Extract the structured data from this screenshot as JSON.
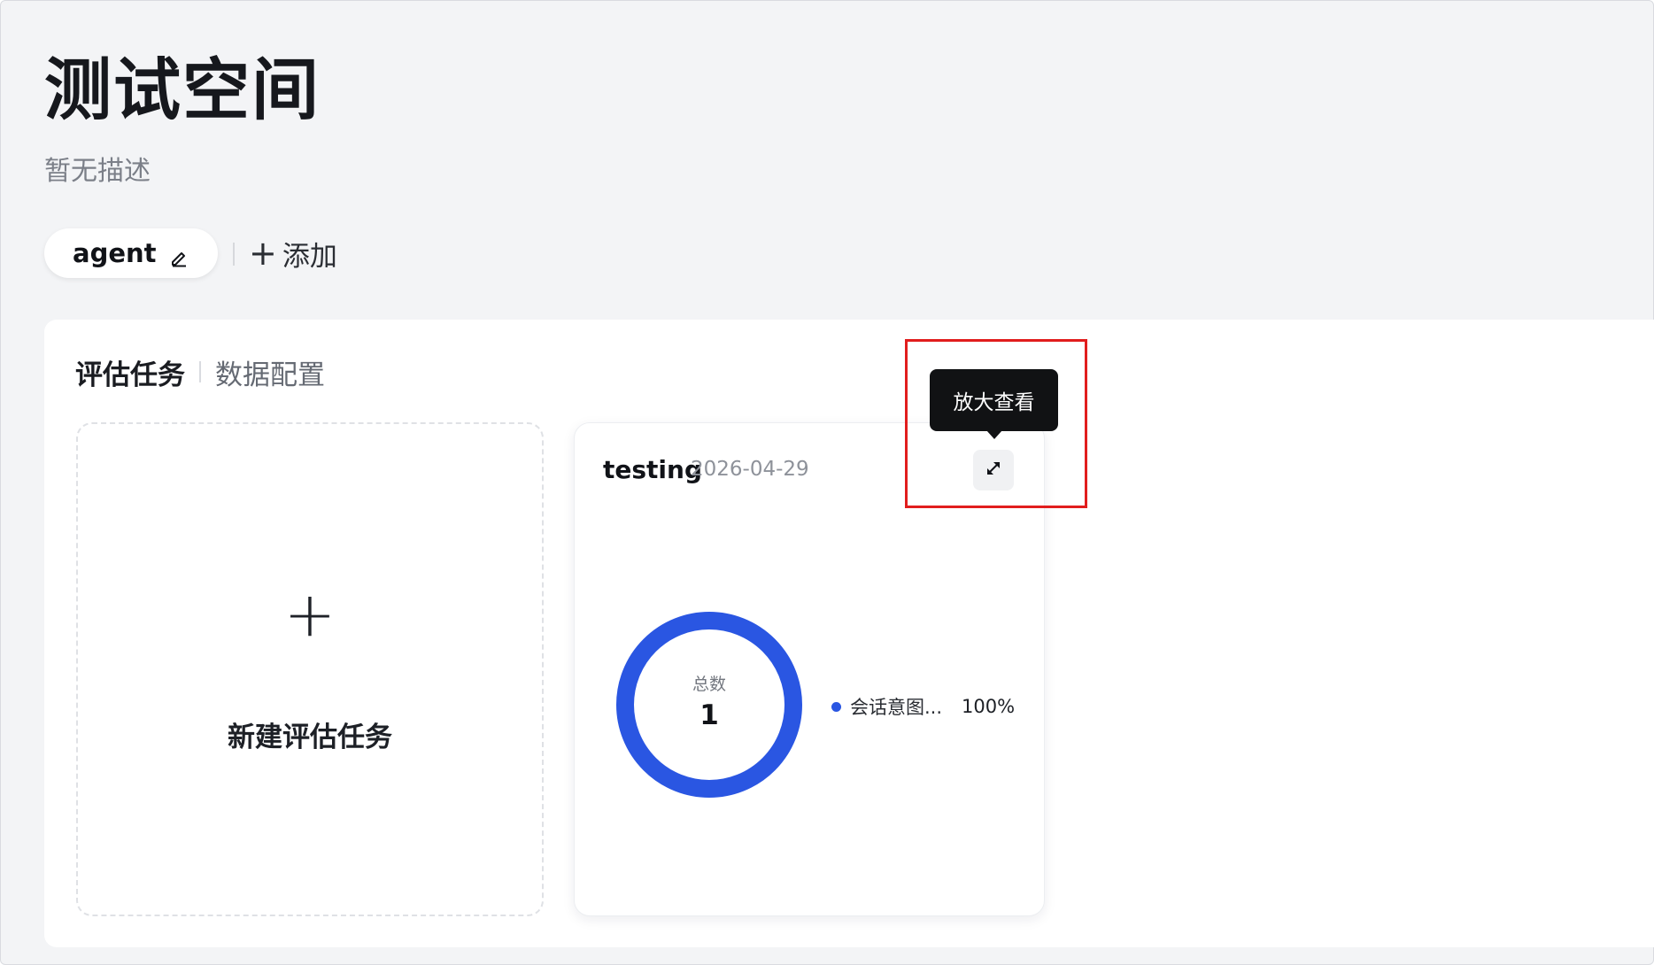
{
  "header": {
    "title": "测试空间",
    "description": "暂无描述"
  },
  "agent_tabs": {
    "active_label": "agent",
    "add_label": "添加",
    "add_symbol": "+"
  },
  "section_tabs": [
    {
      "label": "评估任务",
      "active": true
    },
    {
      "label": "数据配置",
      "active": false
    }
  ],
  "new_task_card": {
    "symbol": "+",
    "label": "新建评估任务"
  },
  "task_card": {
    "name": "testing",
    "date": "2026-04-29",
    "tooltip": "放大查看",
    "donut": {
      "center_label": "总数",
      "center_value": "1"
    },
    "legend": [
      {
        "label": "会话意图...",
        "percent": "100%",
        "color": "#2a56e2"
      }
    ]
  },
  "colors": {
    "accent": "#2a56e2",
    "highlight": "#e11d1d"
  }
}
